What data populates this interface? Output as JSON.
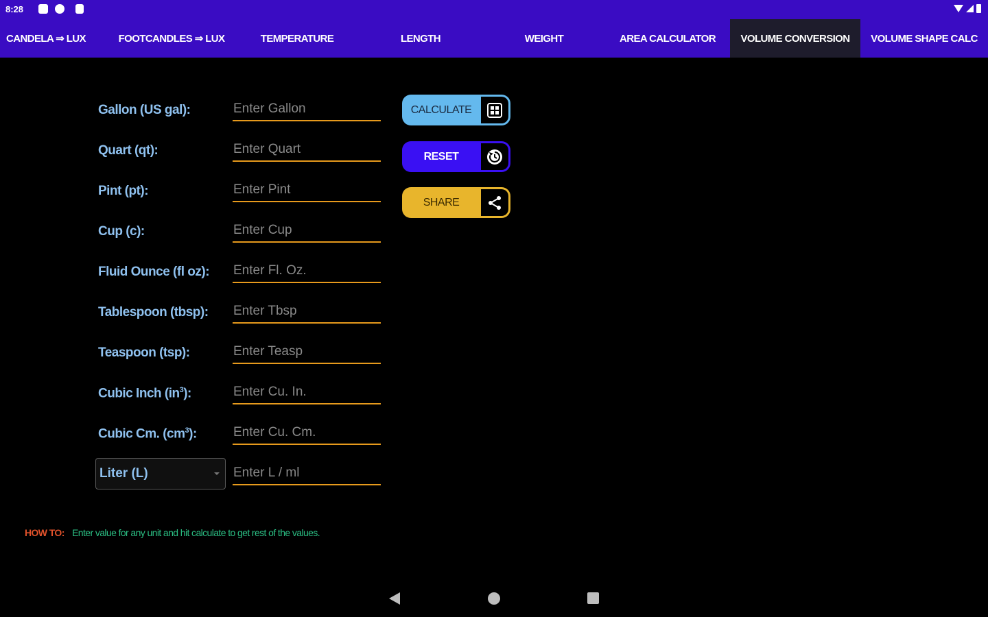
{
  "status_bar": {
    "time": "8:28"
  },
  "tabs": [
    {
      "label": "CANDELA ⇒ LUX"
    },
    {
      "label": "FOOTCANDLES ⇒ LUX"
    },
    {
      "label": "TEMPERATURE"
    },
    {
      "label": "LENGTH"
    },
    {
      "label": "WEIGHT"
    },
    {
      "label": "AREA CALCULATOR"
    },
    {
      "label": "VOLUME CONVERSION",
      "active": true
    },
    {
      "label": "VOLUME SHAPE CALC"
    }
  ],
  "form": {
    "rows": [
      {
        "label": "Gallon (US gal):",
        "placeholder": "Enter Gallon"
      },
      {
        "label": "Quart (qt):",
        "placeholder": "Enter Quart"
      },
      {
        "label": "Pint (pt):",
        "placeholder": "Enter Pint"
      },
      {
        "label": "Cup (c):",
        "placeholder": "Enter Cup"
      },
      {
        "label": "Fluid Ounce (fl oz):",
        "placeholder": "Enter Fl. Oz."
      },
      {
        "label": "Tablespoon (tbsp):",
        "placeholder": "Enter Tbsp"
      },
      {
        "label": "Teaspoon (tsp):",
        "placeholder": "Enter Teasp"
      },
      {
        "label": "Cubic Inch (in",
        "sup": "3",
        "suffix": "):",
        "placeholder": "Enter Cu. In."
      },
      {
        "label": "Cubic Cm. (cm",
        "sup": "3",
        "suffix": "):",
        "placeholder": "Enter Cu. Cm."
      }
    ],
    "unit_select": {
      "value": "Liter (L)",
      "placeholder": "Enter L / ml"
    }
  },
  "buttons": {
    "calculate": {
      "label": "CALCULATE",
      "icon": "calculator-icon",
      "color": "#64b9ee"
    },
    "reset": {
      "label": "RESET",
      "icon": "reset-icon",
      "color": "#3a10f3"
    },
    "share": {
      "label": "SHARE",
      "icon": "share-icon",
      "color": "#e8b52c"
    }
  },
  "howto": {
    "label": "HOW TO:",
    "text": "Enter value for any unit and hit calculate to get rest of the values."
  },
  "colors": {
    "app_bar": "#3a0cc3",
    "active_tab": "#1e1c2c",
    "field_underline": "#e79a1c",
    "label_text": "#8fc1ef"
  }
}
